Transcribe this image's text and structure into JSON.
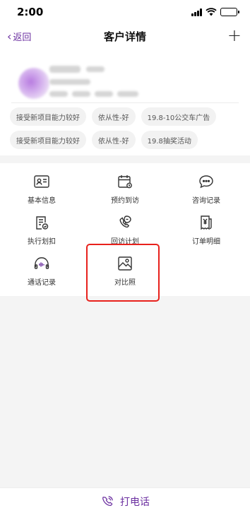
{
  "status_bar": {
    "time": "2:00"
  },
  "nav": {
    "back_label": "返回",
    "title": "客户详情",
    "add_label": "+"
  },
  "profile": {
    "tags": [
      "接受新项目能力较好",
      "依从性-好",
      "19.8-10公交车广告",
      "接受新项目能力较好",
      "依从性-好",
      "19.8抽奖活动"
    ]
  },
  "functions": [
    {
      "label": "基本信息",
      "icon": "id-card-icon"
    },
    {
      "label": "预约到访",
      "icon": "calendar-icon"
    },
    {
      "label": "咨询记录",
      "icon": "chat-bubble-icon"
    },
    {
      "label": "执行划扣",
      "icon": "document-check-icon"
    },
    {
      "label": "回访计划",
      "icon": "phone-chat-icon"
    },
    {
      "label": "订单明细",
      "icon": "receipt-yen-icon"
    },
    {
      "label": "通话记录",
      "icon": "voice-wave-icon"
    },
    {
      "label": "对比照",
      "icon": "image-icon"
    }
  ],
  "call_bar": {
    "label": "打电话",
    "icon": "phone-icon"
  },
  "colors": {
    "accent": "#6b2fa0",
    "highlight": "#e8211c",
    "background": "#f4f4f4"
  }
}
